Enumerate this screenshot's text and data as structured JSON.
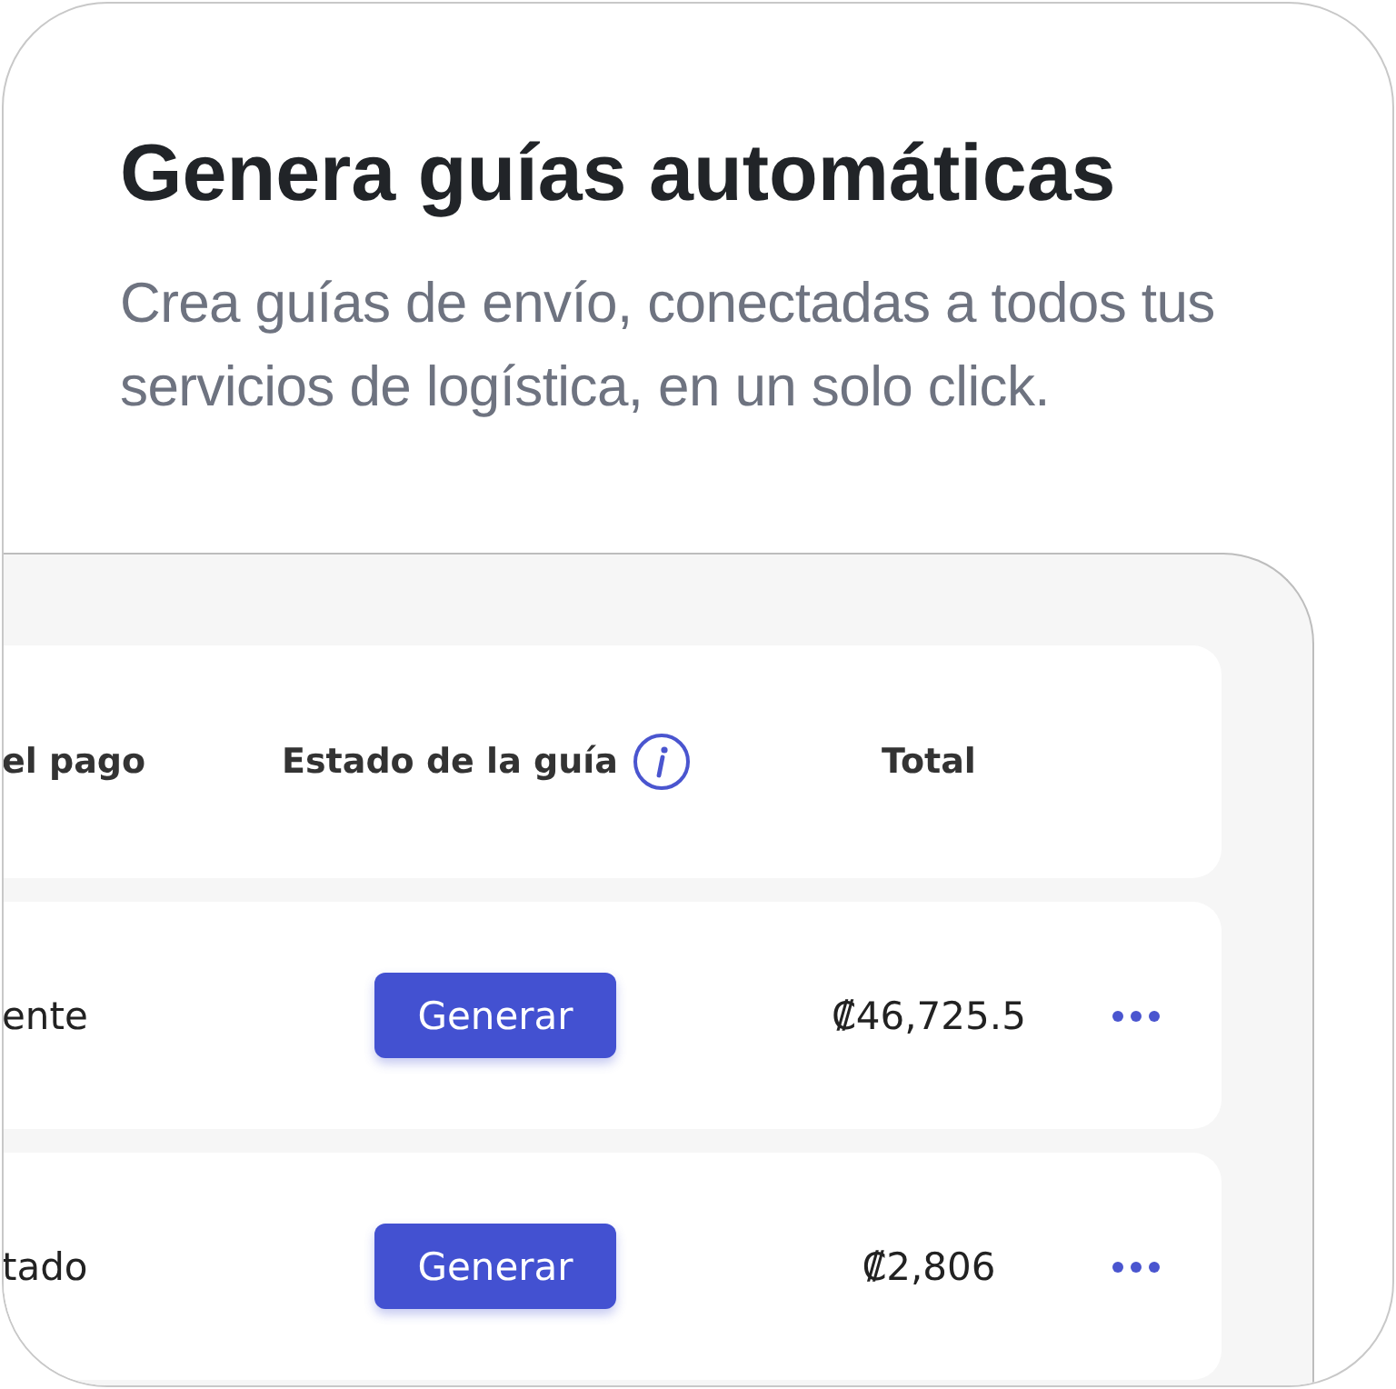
{
  "title": "Genera guías automáticas",
  "subtitle": "Crea guías de envío, conectadas a todos tus servicios de logística, en un solo click.",
  "table": {
    "columns": [
      "el pago",
      "Estado de la guía",
      "Total"
    ],
    "rows": [
      {
        "column_1": "ente",
        "action": "Generar",
        "total": "₡46,725.5"
      },
      {
        "column_1": "tado",
        "action": "Generar",
        "total": "₡2,806"
      }
    ]
  }
}
